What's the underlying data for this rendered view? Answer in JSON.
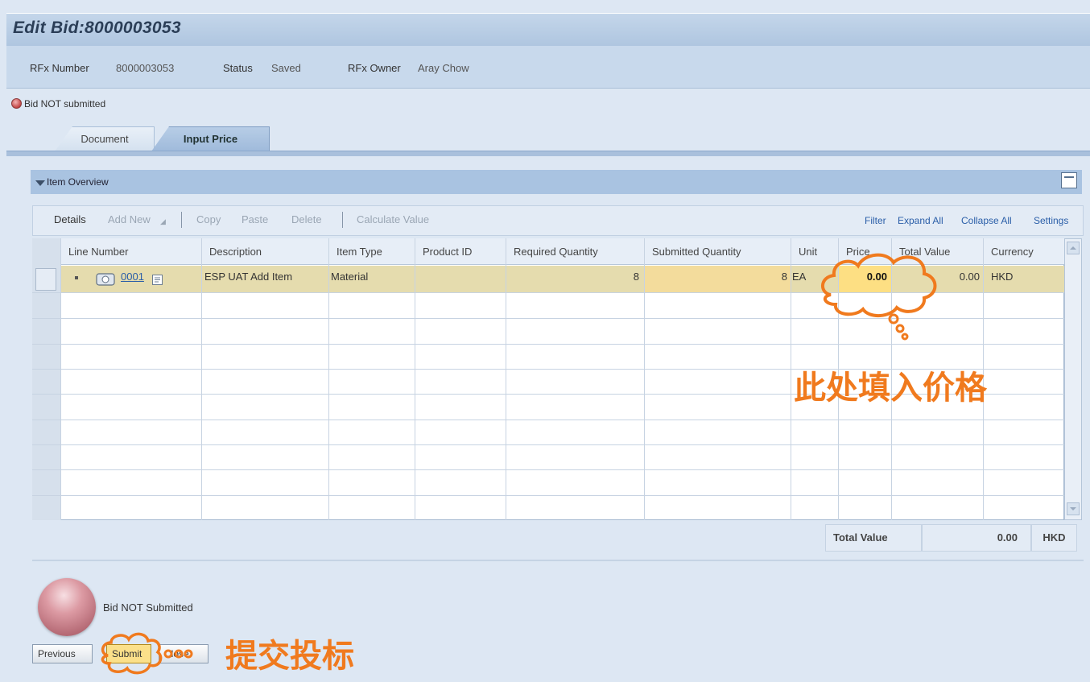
{
  "page": {
    "title": "Edit Bid:8000003053",
    "header": {
      "rfx_number_label": "RFx Number",
      "rfx_number_value": "8000003053",
      "status_label": "Status",
      "status_value": "Saved",
      "owner_label": "RFx Owner",
      "owner_value": "Aray Chow"
    },
    "bid_status": "Bid NOT submitted",
    "tabs": [
      {
        "label": "Document"
      },
      {
        "label": "Input Price"
      }
    ]
  },
  "panel": {
    "title": "Item Overview",
    "toolbar": {
      "details": "Details",
      "add_new": "Add New",
      "copy": "Copy",
      "paste": "Paste",
      "delete": "Delete",
      "calculate": "Calculate Value",
      "filter": "Filter",
      "expand_all": "Expand All",
      "collapse_all": "Collapse All",
      "settings": "Settings"
    },
    "columns": [
      "Line Number",
      "Description",
      "Item Type",
      "Product ID",
      "Required Quantity",
      "Submitted Quantity",
      "Unit",
      "Price",
      "Total Value",
      "Currency"
    ],
    "rows": [
      {
        "line_number": "0001",
        "description": "ESP UAT Add Item",
        "item_type": "Material",
        "product_id": "",
        "required_quantity": "8",
        "submitted_quantity": "8",
        "unit": "EA",
        "price": "0.00",
        "total_value": "0.00",
        "currency": "HKD"
      }
    ],
    "totals": {
      "label": "Total Value",
      "value": "0.00",
      "currency": "HKD"
    }
  },
  "footer": {
    "status_text": "Bid NOT Submitted",
    "buttons": {
      "previous": "Previous",
      "submit": "Submit",
      "close": "Close"
    }
  },
  "annotations": {
    "price_hint": "此处填入价格",
    "submit_hint": "提交投标",
    "color": "#f07a1e"
  }
}
